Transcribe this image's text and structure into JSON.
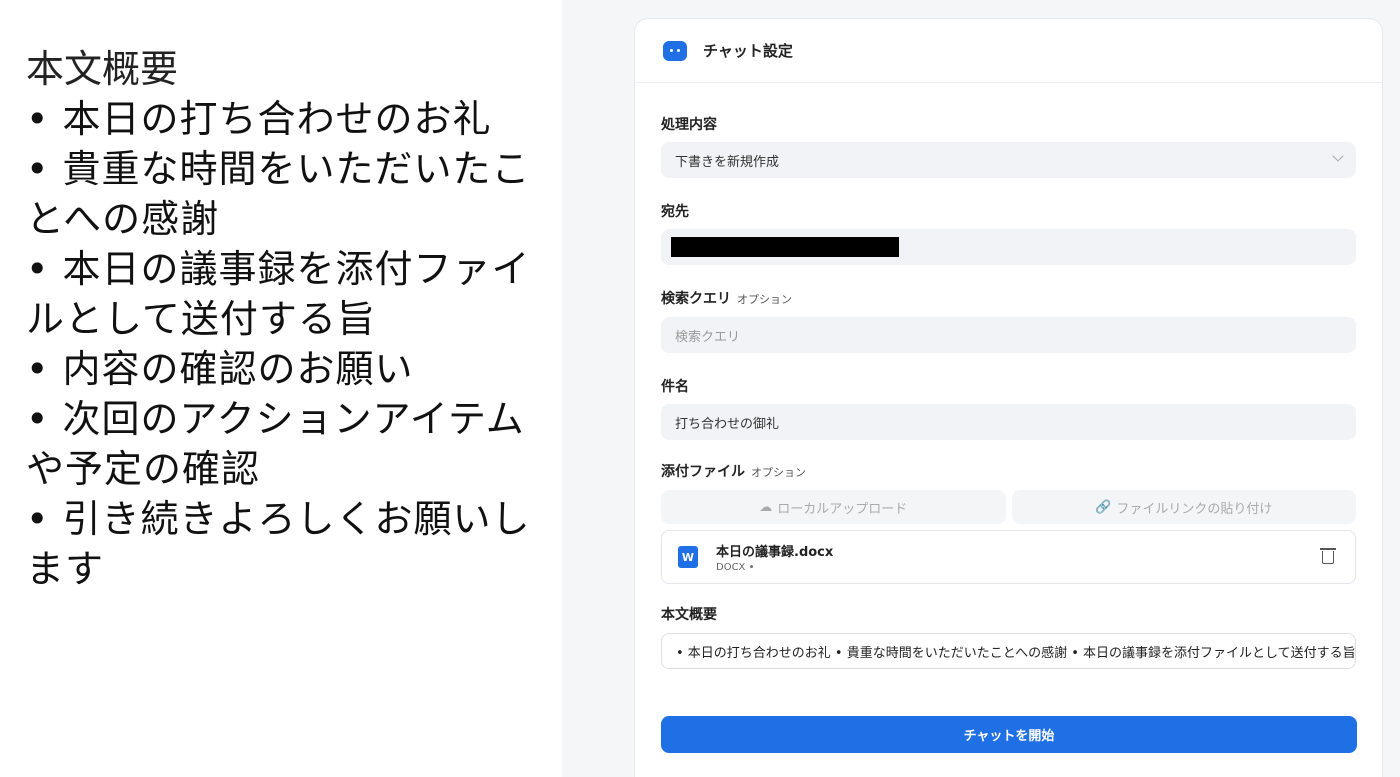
{
  "left": {
    "title": "本文概要",
    "items": [
      "本日の打ち合わせのお礼",
      "貴重な時間をいただいたことへの感謝",
      "本日の議事録を添付ファイルとして送付する旨",
      "内容の確認のお願い",
      "次回のアクションアイテムや予定の確認",
      "引き続きよろしくお願いします"
    ]
  },
  "card": {
    "title": "チャット設定",
    "icon": "bot-icon",
    "accent": "#1f6fe5"
  },
  "form": {
    "process": {
      "label": "処理内容",
      "value": "下書きを新規作成"
    },
    "to": {
      "label": "宛先",
      "value": ""
    },
    "query": {
      "label": "検索クエリ",
      "optional": "オプション",
      "placeholder": "検索クエリ"
    },
    "subject": {
      "label": "件名",
      "value": "打ち合わせの御礼"
    },
    "attach": {
      "label": "添付ファイル",
      "optional": "オプション",
      "upload_label": "ローカルアップロード",
      "link_label": "ファイルリンクの貼り付け"
    },
    "file": {
      "name": "本日の議事録.docx",
      "meta": "DOCX •",
      "badge": "W"
    },
    "summary": {
      "label": "本文概要",
      "value": "• 本日の打ち合わせのお礼 • 貴重な時間をいただいたことへの感謝 • 本日の議事録を添付ファイルとして送付する旨"
    },
    "start_label": "チャットを開始"
  }
}
